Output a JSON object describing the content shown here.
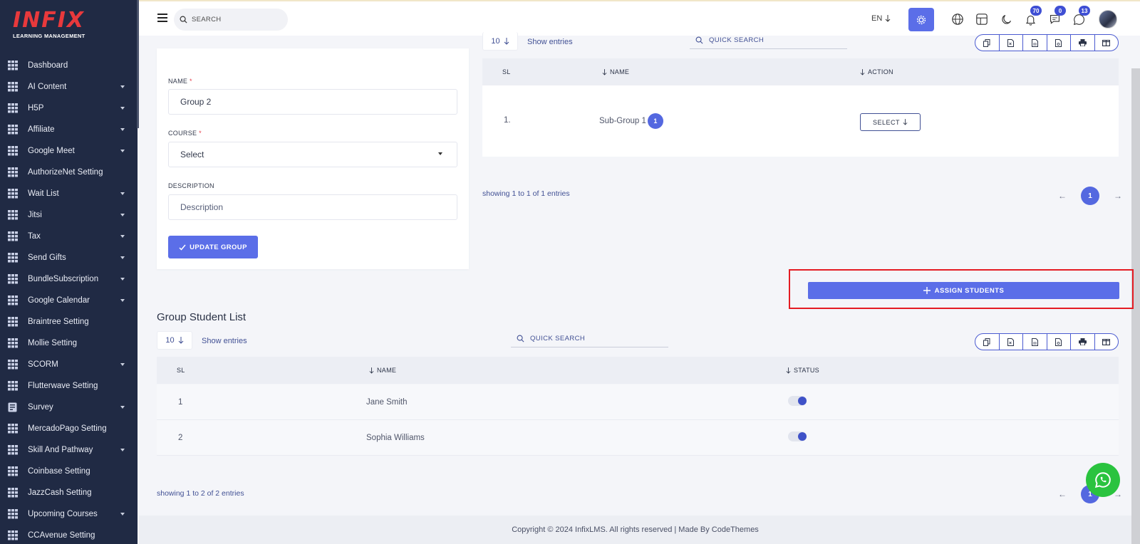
{
  "sidebar": {
    "logo": {
      "main": "INFIX",
      "sub": "LEARNING MANAGEMENT"
    },
    "items": [
      {
        "label": "Dashboard",
        "caret": false
      },
      {
        "label": "AI Content",
        "caret": true
      },
      {
        "label": "H5P",
        "caret": true
      },
      {
        "label": "Affiliate",
        "caret": true
      },
      {
        "label": "Google Meet",
        "caret": true
      },
      {
        "label": "AuthorizeNet Setting",
        "caret": false
      },
      {
        "label": "Wait List",
        "caret": true
      },
      {
        "label": "Jitsi",
        "caret": true
      },
      {
        "label": "Tax",
        "caret": true
      },
      {
        "label": "Send Gifts",
        "caret": true
      },
      {
        "label": "BundleSubscription",
        "caret": true
      },
      {
        "label": "Google Calendar",
        "caret": true
      },
      {
        "label": "Braintree Setting",
        "caret": false
      },
      {
        "label": "Mollie Setting",
        "caret": false
      },
      {
        "label": "SCORM",
        "caret": true
      },
      {
        "label": "Flutterwave Setting",
        "caret": false
      },
      {
        "label": "Survey",
        "caret": true
      },
      {
        "label": "MercadoPago Setting",
        "caret": false
      },
      {
        "label": "Skill And Pathway",
        "caret": true
      },
      {
        "label": "Coinbase Setting",
        "caret": false
      },
      {
        "label": "JazzCash Setting",
        "caret": false
      },
      {
        "label": "Upcoming Courses",
        "caret": true
      },
      {
        "label": "CCAvenue Setting",
        "caret": false
      }
    ]
  },
  "topbar": {
    "search_placeholder": "SEARCH",
    "language": "EN",
    "notifications_count": "70",
    "messages_count": "0",
    "chats_count": "13"
  },
  "form": {
    "name_label": "NAME",
    "name_value": "Group 2",
    "course_label": "COURSE",
    "course_value": "Select",
    "description_label": "DESCRIPTION",
    "description_placeholder": "Description",
    "required_mark": "*",
    "update_button": "UPDATE GROUP"
  },
  "subgroups": {
    "entries": "10",
    "entries_label": "Show entries",
    "quick_search": "QUICK SEARCH",
    "columns": [
      "SL",
      "NAME",
      "ACTION"
    ],
    "rows": [
      {
        "sl": "1.",
        "name": "Sub-Group 1",
        "badge": "1",
        "action": "SELECT"
      }
    ],
    "showing": "showing 1 to 1 of 1 entries",
    "current_page": "1"
  },
  "assign_button": "ASSIGN STUDENTS",
  "students": {
    "title": "Group Student List",
    "entries": "10",
    "entries_label": "Show entries",
    "quick_search": "QUICK SEARCH",
    "columns": [
      "SL",
      "NAME",
      "STATUS"
    ],
    "rows": [
      {
        "sl": "1",
        "name": "Jane Smith",
        "status": true
      },
      {
        "sl": "2",
        "name": "Sophia Williams",
        "status": true
      }
    ],
    "showing": "showing 1 to 2 of 2 entries",
    "current_page": "1"
  },
  "footer": "Copyright © 2024 InfixLMS. All rights reserved | Made By CodeThemes",
  "colors": {
    "primary": "#5b6ee8",
    "sidebar": "#202a44",
    "highlight": "#e41c23",
    "whatsapp": "#2ac33f"
  }
}
